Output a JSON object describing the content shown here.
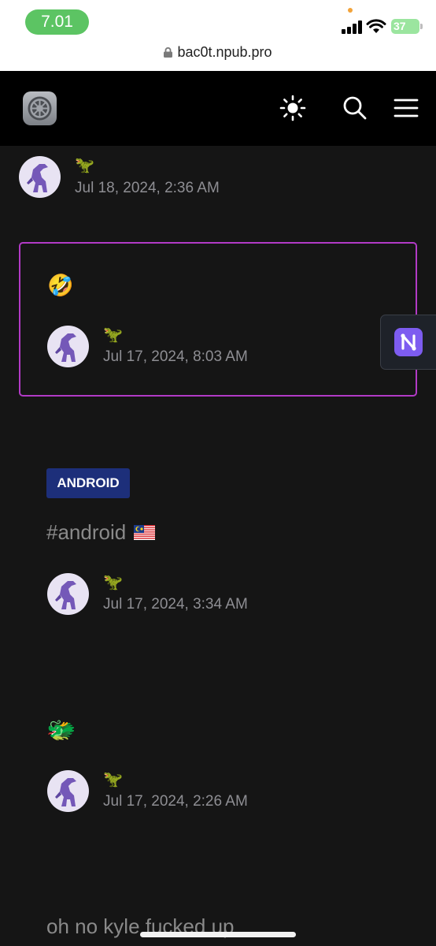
{
  "status_bar": {
    "time": "7.01",
    "battery": "37"
  },
  "browser": {
    "url": "bac0t.npub.pro"
  },
  "header": {
    "logo_icon": "settings-gear-icon",
    "theme_icon": "sun-icon",
    "search_icon": "search-icon",
    "menu_icon": "hamburger-menu-icon"
  },
  "posts": [
    {
      "author_emoji": "🦖",
      "date": "Jul 18, 2024, 2:36 AM"
    },
    {
      "content_emoji": "🤣",
      "author_emoji": "🦖",
      "date": "Jul 17, 2024, 8:03 AM"
    },
    {
      "tag": "ANDROID",
      "text": "#android",
      "author_emoji": "🦖",
      "date": "Jul 17, 2024, 3:34 AM"
    },
    {
      "content_emoji": "🐲",
      "author_emoji": "🦖",
      "date": "Jul 17, 2024, 2:26 AM"
    },
    {
      "text": "oh no kyle fucked up"
    }
  ],
  "widget": {
    "icon": "nostr-n-icon",
    "color": "#7d5cf0"
  },
  "colors": {
    "highlight_border": "#b23ac6",
    "tag_bg": "#1d2f7a",
    "background": "#151515"
  }
}
